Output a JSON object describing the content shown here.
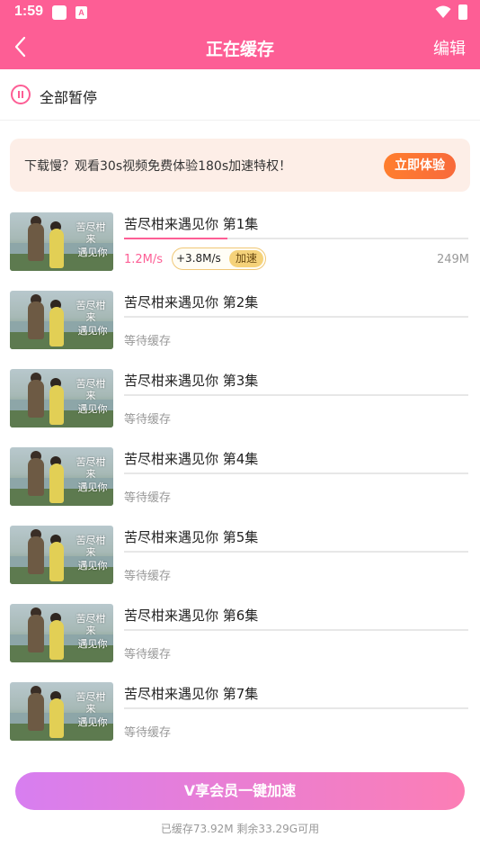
{
  "status_bar": {
    "time": "1:59",
    "icon_badge": "A"
  },
  "header": {
    "title": "正在缓存",
    "edit_label": "编辑",
    "back_icon": "chevron-left-icon",
    "bg_color": "#fd5e95"
  },
  "pause_all": {
    "label": "全部暂停",
    "icon": "pause-circle-icon"
  },
  "promo_banner": {
    "text": "下载慢？观看30s视频免费体验180s加速特权！",
    "button": "立即体验"
  },
  "thumbnail_title": [
    "苦尽柑来",
    "遇见你"
  ],
  "downloads": [
    {
      "title": "苦尽柑来遇见你 第1集",
      "status": "downloading",
      "progress": 0.3,
      "speed": "1.2M/s",
      "boost_speed": "+3.8M/s",
      "boost_label": "加速",
      "size": "249M"
    },
    {
      "title": "苦尽柑来遇见你 第2集",
      "status": "等待缓存"
    },
    {
      "title": "苦尽柑来遇见你 第3集",
      "status": "等待缓存"
    },
    {
      "title": "苦尽柑来遇见你 第4集",
      "status": "等待缓存"
    },
    {
      "title": "苦尽柑来遇见你 第5集",
      "status": "等待缓存"
    },
    {
      "title": "苦尽柑来遇见你 第6集",
      "status": "等待缓存"
    },
    {
      "title": "苦尽柑来遇见你 第7集",
      "status": "等待缓存"
    }
  ],
  "vip_button": {
    "label": "V享会员一键加速"
  },
  "storage_info": "已缓存73.92M 剩余33.29G可用"
}
